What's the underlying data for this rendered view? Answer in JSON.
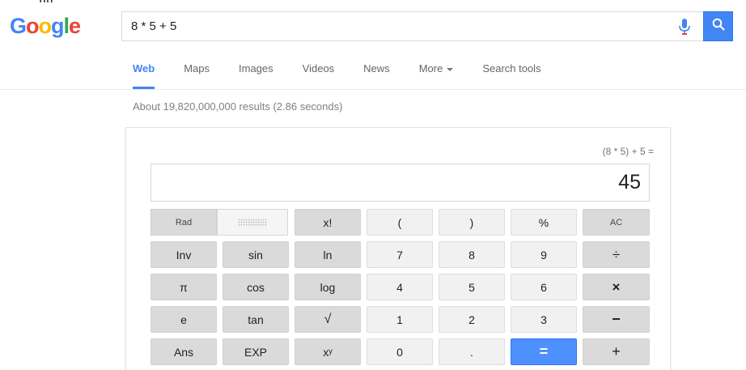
{
  "logo": {
    "letters": [
      "G",
      "o",
      "o",
      "g",
      "l",
      "e"
    ],
    "colors": [
      "#4285f4",
      "#ea4335",
      "#fbbc05",
      "#4285f4",
      "#34a853",
      "#ea4335"
    ]
  },
  "clipped_text": "ng",
  "search": {
    "query": "8 * 5 + 5",
    "mic_icon": "microphone-icon",
    "search_icon": "magnifier-icon",
    "accent": "#4285f4"
  },
  "tabs": [
    {
      "label": "Web",
      "active": true
    },
    {
      "label": "Maps"
    },
    {
      "label": "Images"
    },
    {
      "label": "Videos"
    },
    {
      "label": "News"
    },
    {
      "label": "More"
    },
    {
      "label": "Search tools"
    }
  ],
  "results_count": "About 19,820,000,000 results (2.86 seconds)",
  "calculator": {
    "expression": "(8 * 5) + 5 =",
    "result": "45",
    "rad_label": "Rad",
    "rows": [
      [
        "x!",
        "(",
        ")",
        "%",
        "AC"
      ],
      [
        "Inv",
        "sin",
        "ln",
        "7",
        "8",
        "9",
        "÷"
      ],
      [
        "π",
        "cos",
        "log",
        "4",
        "5",
        "6",
        "×"
      ],
      [
        "e",
        "tan",
        "√",
        "1",
        "2",
        "3",
        "−"
      ],
      [
        "Ans",
        "EXP",
        "xʸ",
        "0",
        ".",
        "=",
        "+"
      ]
    ]
  }
}
